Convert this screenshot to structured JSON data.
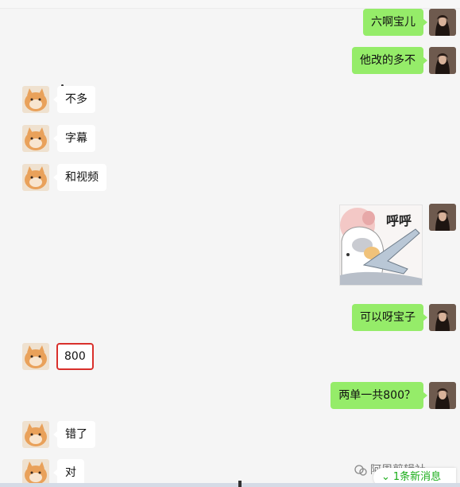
{
  "messages": [
    {
      "side": "me",
      "text": "六啊宝儿"
    },
    {
      "side": "me",
      "text": "他改的多不"
    },
    {
      "side": "them",
      "text": "不多"
    },
    {
      "side": "them",
      "text": "字幕"
    },
    {
      "side": "them",
      "text": "和视频"
    },
    {
      "side": "me",
      "type": "sticker",
      "text": "呼呼"
    },
    {
      "side": "me",
      "text": "可以呀宝子"
    },
    {
      "side": "them",
      "text": "800"
    },
    {
      "side": "me",
      "text": "两单一共800？"
    },
    {
      "side": "them",
      "text": "错了"
    },
    {
      "side": "them",
      "text": "对"
    }
  ],
  "watermark": "阿周剪辑社",
  "new_message_tip": "1条新消息",
  "colors": {
    "my_bubble": "#95ec69",
    "their_bubble": "#ffffff",
    "highlight_border": "#d9302c",
    "new_message_text": "#1aad19"
  }
}
